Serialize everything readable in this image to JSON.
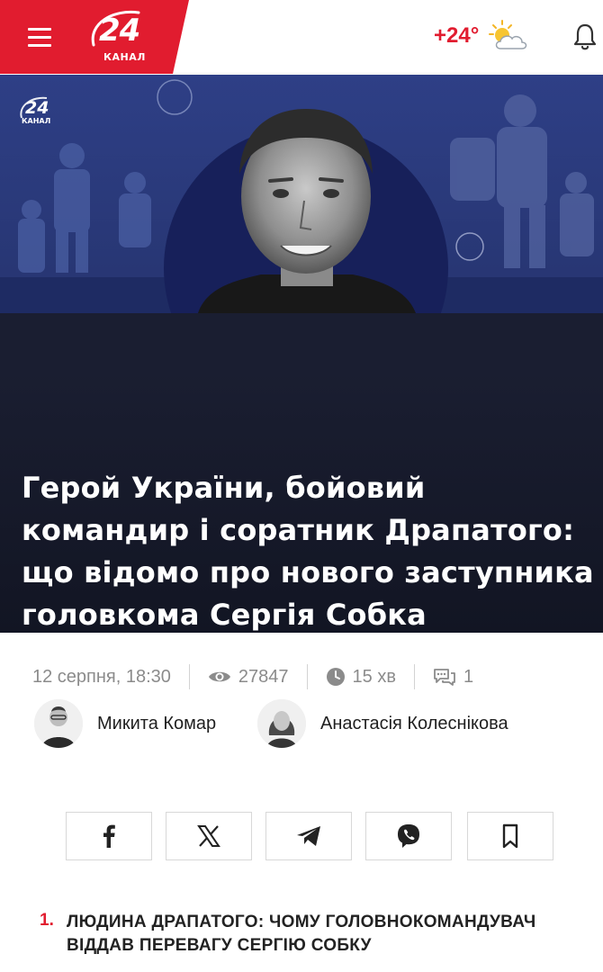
{
  "header": {
    "logo_number": "24",
    "logo_sub": "КАНАЛ",
    "temperature": "+24°",
    "brand_color": "#e11c2f",
    "menu_icon": "hamburger-menu-icon",
    "weather_icon": "sun-cloud-icon",
    "bell_icon": "bell-icon"
  },
  "hero": {
    "watermark_number": "24",
    "watermark_sub": "КАНАЛ",
    "title": "Герой України, бойовий командир і соратник Драпатого: що відомо про нового заступника головкома Сергія Собка"
  },
  "meta": {
    "date": "12 серпня, 18:30",
    "views": "27847",
    "read_time": "15 хв",
    "comments": "1"
  },
  "authors": [
    {
      "name": "Микита Комар"
    },
    {
      "name": "Анастасія Колеснікова"
    }
  ],
  "share": [
    {
      "icon": "facebook-icon"
    },
    {
      "icon": "x-twitter-icon"
    },
    {
      "icon": "telegram-icon"
    },
    {
      "icon": "viber-icon"
    },
    {
      "icon": "bookmark-icon"
    }
  ],
  "toc": [
    {
      "num": "1.",
      "text": "ЛЮДИНА ДРАПАТОГО: ЧОМУ ГОЛОВНОКОМАНДУВАЧ ВІДДАВ ПЕРЕВАГУ СЕРГІЮ СОБКУ"
    }
  ]
}
